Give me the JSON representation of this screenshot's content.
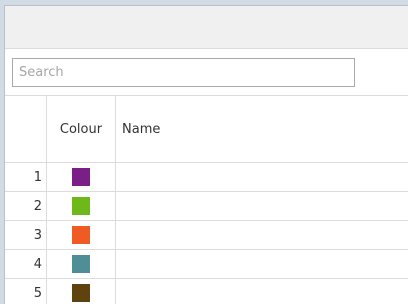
{
  "search": {
    "placeholder": "Search"
  },
  "table": {
    "columns": {
      "index": "",
      "colour": "Colour",
      "name": "Name"
    },
    "rows": [
      {
        "index": "1",
        "colour": "#7a1f86",
        "name": ""
      },
      {
        "index": "2",
        "colour": "#6fb81a",
        "name": ""
      },
      {
        "index": "3",
        "colour": "#f05a23",
        "name": ""
      },
      {
        "index": "4",
        "colour": "#4f8e96",
        "name": ""
      },
      {
        "index": "5",
        "colour": "#5e430e",
        "name": ""
      }
    ]
  }
}
